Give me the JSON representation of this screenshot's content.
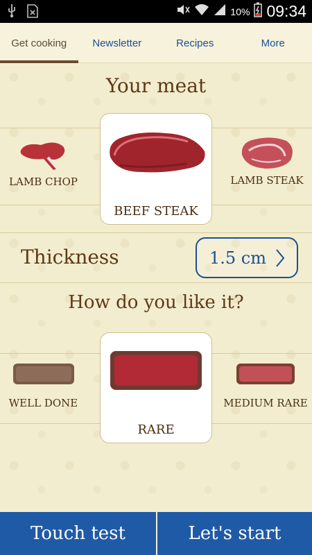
{
  "status_bar": {
    "time": "09:34",
    "battery_percent": "10%"
  },
  "tabs": [
    {
      "label": "Get cooking"
    },
    {
      "label": "Newsletter"
    },
    {
      "label": "Recipes"
    },
    {
      "label": "More"
    }
  ],
  "meat": {
    "heading": "Your meat",
    "left_label": "LAMB CHOP",
    "selected_label": "BEEF STEAK",
    "right_label": "LAMB STEAK"
  },
  "thickness": {
    "label": "Thickness",
    "value": "1.5 cm"
  },
  "doneness": {
    "heading": "How do you like it?",
    "left_label": "WELL DONE",
    "selected_label": "RARE",
    "right_label": "MEDIUM RARE"
  },
  "buttons": {
    "touch_test": "Touch test",
    "lets_start": "Let's start"
  },
  "colors": {
    "accent_blue": "#1f5aa6",
    "heading_brown": "#5c3a16",
    "background": "#f3edcf"
  }
}
